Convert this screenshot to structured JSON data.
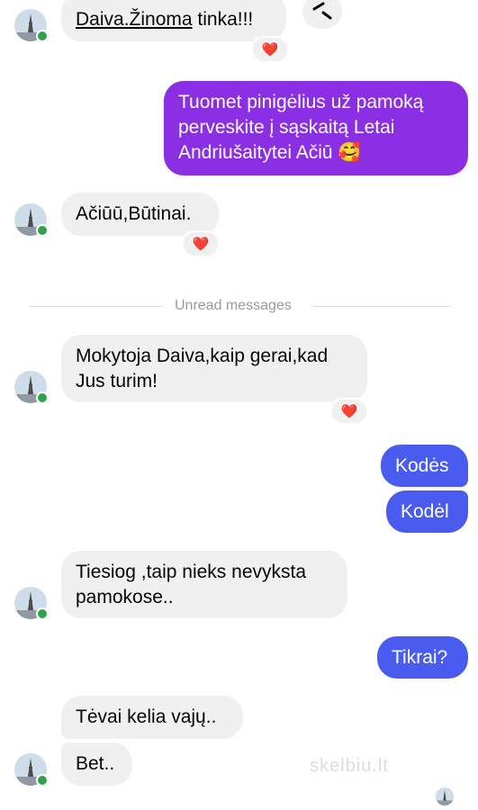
{
  "colors": {
    "incoming_bubble": "#f0f0f0",
    "outgoing_purple": "#8a2fe3",
    "outgoing_blue": "#4a5cf0",
    "reaction_heart": "#e41e3f",
    "online_dot": "#31a24c"
  },
  "messages": {
    "m1": {
      "link_text": "Daiva.Žinoma",
      "rest_text": " tinka!!!",
      "reaction": "❤️"
    },
    "m2": {
      "text": "Tuomet pinigėlius už pamoką perveskite į sąskaitą Letai Andriušaitytei Ačiū 🥰"
    },
    "m3": {
      "text": "Ačiūū,Būtinai.",
      "reaction": "❤️"
    },
    "divider": {
      "text": "Unread messages"
    },
    "m4": {
      "text": "Mokytoja Daiva,kaip gerai,kad Jus turim!",
      "reaction": "❤️"
    },
    "m5": {
      "text": "Kodės"
    },
    "m6": {
      "text": "Kodėl"
    },
    "m7": {
      "text": "Tiesiog ,taip nieks nevyksta pamokose.."
    },
    "m8": {
      "text": "Tikrai?"
    },
    "m9": {
      "text": "Tėvai kelia vajų.."
    },
    "m10": {
      "text": "Bet.."
    }
  },
  "watermark": {
    "text": "skelbiu.lt"
  },
  "icons": {
    "share": "share-icon",
    "heart": "heart-icon",
    "avatar": "avatar-icon"
  }
}
